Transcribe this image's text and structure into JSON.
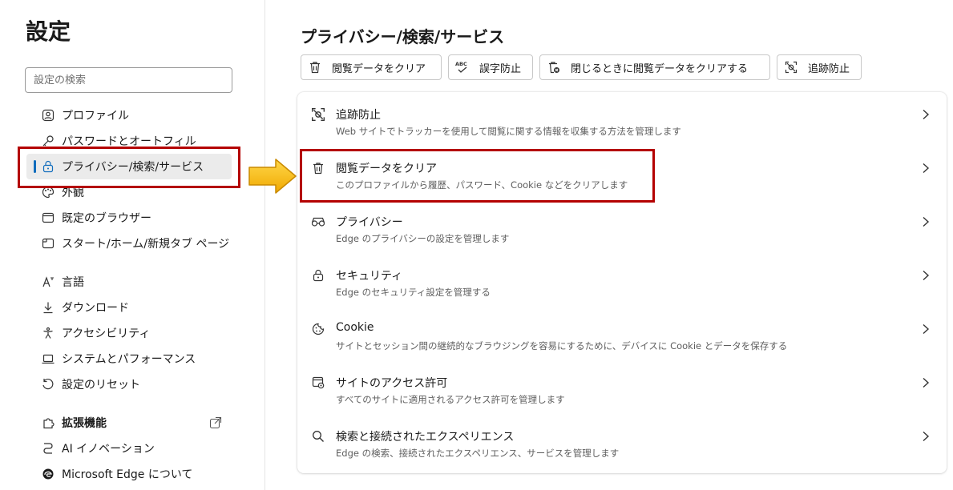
{
  "sidebar": {
    "title": "設定",
    "search_placeholder": "設定の検索",
    "items": [
      {
        "label": "プロファイル",
        "icon": "profile-icon"
      },
      {
        "label": "パスワードとオートフィル",
        "icon": "key-icon"
      },
      {
        "label": "プライバシー/検索/サービス",
        "icon": "lock-icon",
        "active": true
      },
      {
        "label": "外観",
        "icon": "palette-icon"
      },
      {
        "label": "既定のブラウザー",
        "icon": "browser-icon"
      },
      {
        "label": "スタート/ホーム/新規タブ ページ",
        "icon": "home-icon"
      },
      {
        "label": "言語",
        "icon": "language-icon"
      },
      {
        "label": "ダウンロード",
        "icon": "download-icon"
      },
      {
        "label": "アクセシビリティ",
        "icon": "accessibility-icon"
      },
      {
        "label": "システムとパフォーマンス",
        "icon": "laptop-icon"
      },
      {
        "label": "設定のリセット",
        "icon": "reset-icon"
      },
      {
        "label": "拡張機能",
        "icon": "puzzle-icon"
      },
      {
        "label": "AI イノベーション",
        "icon": "ai-icon"
      },
      {
        "label": "Microsoft Edge について",
        "icon": "edge-icon"
      }
    ]
  },
  "main": {
    "title": "プライバシー/検索/サービス",
    "chips": [
      {
        "label": "閲覧データをクリア",
        "icon": "trash-icon"
      },
      {
        "label": "誤字防止",
        "icon": "spellcheck-icon"
      },
      {
        "label": "閉じるときに閲覧データをクリアする",
        "icon": "trash-close-icon"
      },
      {
        "label": "追跡防止",
        "icon": "tracking-icon"
      }
    ],
    "rows": [
      {
        "title": "追跡防止",
        "desc": "Web サイトでトラッカーを使用して閲覧に関する情報を収集する方法を管理します",
        "icon": "tracking-icon"
      },
      {
        "title": "閲覧データをクリア",
        "desc": "このプロファイルから履歴、パスワード、Cookie などをクリアします",
        "icon": "trash-icon"
      },
      {
        "title": "プライバシー",
        "desc": "Edge のプライバシーの設定を管理します",
        "icon": "glasses-icon"
      },
      {
        "title": "セキュリティ",
        "desc": "Edge のセキュリティ設定を管理する",
        "icon": "lock-icon"
      },
      {
        "title": "Cookie",
        "desc": "サイトとセッション間の継続的なブラウジングを容易にするために、デバイスに Cookie とデータを保存する",
        "icon": "cookie-icon"
      },
      {
        "title": "サイトのアクセス許可",
        "desc": "すべてのサイトに適用されるアクセス許可を管理します",
        "icon": "site-permissions-icon"
      },
      {
        "title": "検索と接続されたエクスペリエンス",
        "desc": "Edge の検索、接続されたエクスペリエンス、サービスを管理します",
        "icon": "search-icon"
      }
    ]
  },
  "colors": {
    "highlight_box": "#b40000",
    "arrow_fill": "#f5b800",
    "active_indicator": "#0f6cbd"
  }
}
